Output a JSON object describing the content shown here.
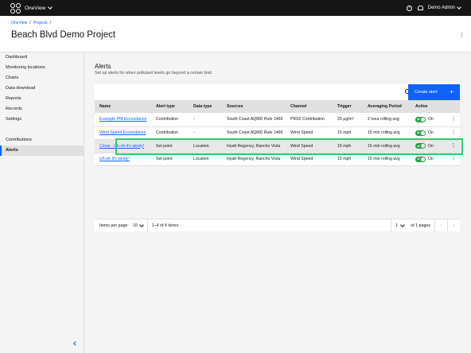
{
  "topbar": {
    "brand": "OneView",
    "help_glyph": "?",
    "user": "Demo Admin"
  },
  "header": {
    "breadcrumb": [
      "OneView",
      "Projects"
    ],
    "title": "Beach Blvd Demo Project"
  },
  "sidebar": {
    "items": [
      "Dashboard",
      "Monitoring locations",
      "Charts",
      "Data download",
      "Reports",
      "Records",
      "Settings"
    ],
    "items2": [
      "Contributions",
      "Alerts"
    ],
    "active": "Alerts"
  },
  "alerts": {
    "title": "Alerts",
    "description": "Set up alerts for when pollutant levels go beyond a certain limit.",
    "create_label": "Create alert",
    "plus": "+",
    "columns": {
      "name": "Name",
      "alert_type": "Alert type",
      "data_type": "Data type",
      "sources": "Sources",
      "channel": "Channel",
      "trigger": "Trigger",
      "averaging": "Averaging Period",
      "active": "Active"
    },
    "rows": [
      {
        "name": "Example PM Exceedance",
        "alert_type": "Contribution",
        "data_type": "-",
        "sources": "South Coast AQMD Rule 1466",
        "channel": "PM10 Contribution",
        "trigger": "25 μg/m³",
        "averaging": "2 hour rolling avg",
        "active": "On"
      },
      {
        "name": "Wind Speed Exceedance",
        "alert_type": "Contribution",
        "data_type": "-",
        "sources": "South Coast AQMD Rule 1466",
        "channel": "Wind Speed",
        "trigger": "15 mph",
        "averaging": "15 min rolling avg",
        "active": "On"
      },
      {
        "name": "Clone - Uh-oh it's windy!",
        "alert_type": "Set point",
        "data_type": "Location",
        "sources": "Hyatt Regency, Rancho Vista",
        "channel": "Wind Speed",
        "trigger": "15 mph",
        "averaging": "15 min rolling avg",
        "active": "On"
      },
      {
        "name": "Uh-oh it's windy!",
        "alert_type": "Set point",
        "data_type": "Location",
        "sources": "Hyatt Regency, Rancho Vista",
        "channel": "Wind Speed",
        "trigger": "15 mph",
        "averaging": "15 min rolling avg",
        "active": "On"
      }
    ]
  },
  "pagination": {
    "items_per_page_label": "Items per page:",
    "items_per_page": "10",
    "range": "1–4 of 4 items",
    "page": "1",
    "total_pages": "of 1 pages",
    "prev_glyph": "‹",
    "next_glyph": "›"
  },
  "colors": {
    "accent": "#0f62fe",
    "toggle_on": "#24a148",
    "highlight": "#2ecc71"
  }
}
